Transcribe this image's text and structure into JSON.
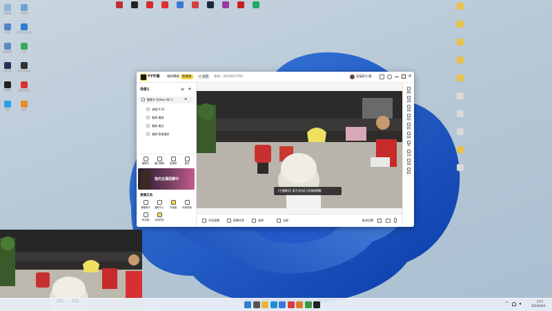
{
  "desktop_left": [
    {
      "label": "回收站",
      "color": "#8fb3d8"
    },
    {
      "label": "此电脑",
      "color": "#6fa0d6"
    },
    {
      "label": "网络",
      "color": "#4f86c6"
    },
    {
      "label": "Microsoft Edge",
      "color": "#2d7fd3"
    },
    {
      "label": "控制面板",
      "color": "#5a8ac2"
    },
    {
      "label": "下载",
      "color": "#3aa85a"
    },
    {
      "label": "Steam",
      "color": "#223355"
    },
    {
      "label": "OBS Studio",
      "color": "#333333"
    },
    {
      "label": "YY开播",
      "color": "#222222"
    },
    {
      "label": "网易云音乐",
      "color": "#d8322e"
    },
    {
      "label": "QQ",
      "color": "#2a9ee8"
    },
    {
      "label": "照片",
      "color": "#e88a2a"
    }
  ],
  "desktop_top": [
    {
      "label": "",
      "color": "#c03030"
    },
    {
      "label": "",
      "color": "#222222"
    },
    {
      "label": "",
      "color": "#d02a2a"
    },
    {
      "label": "",
      "color": "#e03030"
    },
    {
      "label": "",
      "color": "#3b78d8"
    },
    {
      "label": "",
      "color": "#d44040"
    },
    {
      "label": "",
      "color": "#1b2838"
    },
    {
      "label": "",
      "color": "#9a3aa8"
    },
    {
      "label": "",
      "color": "#c82020"
    },
    {
      "label": "",
      "color": "#20a860"
    }
  ],
  "desktop_right": [
    {
      "label": "",
      "color": "#e8c24a"
    },
    {
      "label": "",
      "color": "#e8c24a"
    },
    {
      "label": "",
      "color": "#e8c24a"
    },
    {
      "label": "",
      "color": "#e8c24a"
    },
    {
      "label": "",
      "color": "#e8c24a"
    },
    {
      "label": "",
      "color": "#d9d9d9"
    },
    {
      "label": "",
      "color": "#d9d9d9"
    },
    {
      "label": "",
      "color": "#d9d9d9"
    },
    {
      "label": "",
      "color": "#e8c24a"
    },
    {
      "label": "",
      "color": "#d9d9d9"
    }
  ],
  "window": {
    "brand": "YY开播",
    "tab_label": "福利模板",
    "tab_badge": "新模板",
    "back_label": "< 返回",
    "room_label": "房号：2253017707",
    "user_name": "逗猫的小鬼",
    "scene_title": "场景1",
    "source_main": "摄像头-Dijiaso 4K 3",
    "sources": [
      "滤镜-9:16",
      "美颜-磨皮",
      "美颜-美白",
      "美颜-智能瘦脸"
    ],
    "tools": [
      {
        "label": "摄像头",
        "icon": "camera-icon"
      },
      {
        "label": "窗口捕获",
        "icon": "window-icon"
      },
      {
        "label": "多媒体",
        "icon": "media-icon"
      },
      {
        "label": "更多",
        "icon": "plus-icon"
      }
    ],
    "banner_text": "签约主播招募中",
    "activity_title": "直播互动",
    "activity_items": [
      {
        "label": "弹幕助手",
        "icon": "chat-icon"
      },
      {
        "label": "福利中心",
        "icon": "gift-icon"
      },
      {
        "label": "开宝箱",
        "icon": "box-icon"
      },
      {
        "label": "电竞竞猜",
        "icon": "trophy-icon"
      },
      {
        "label": "粉丝团",
        "icon": "fans-icon"
      },
      {
        "label": "活动任务",
        "icon": "task-icon"
      }
    ],
    "toast": "【主播模式】暂不支持此人脸美颜模糊",
    "right_tools": [
      "美颜",
      "滤镜",
      "贴纸",
      "特效",
      "音效",
      "连麦",
      "PK",
      "互动",
      "设置",
      "更多"
    ],
    "bottom_items": [
      "开启直播",
      "屏幕共享",
      "录屏",
      "全屏"
    ],
    "bottom_right": "推流设置"
  },
  "taskbar": {
    "icons": [
      {
        "name": "start",
        "color": "#2d7fd3"
      },
      {
        "name": "search",
        "color": "#555555"
      },
      {
        "name": "files",
        "color": "#e8b43a"
      },
      {
        "name": "edge",
        "color": "#1e90d8"
      },
      {
        "name": "store",
        "color": "#3a78d8"
      },
      {
        "name": "app1",
        "color": "#d84040"
      },
      {
        "name": "app2",
        "color": "#e07a2a"
      },
      {
        "name": "app3",
        "color": "#3a9a3a"
      },
      {
        "name": "yy",
        "color": "#222222"
      }
    ],
    "time": "2:57",
    "date": "2024/4/10"
  }
}
